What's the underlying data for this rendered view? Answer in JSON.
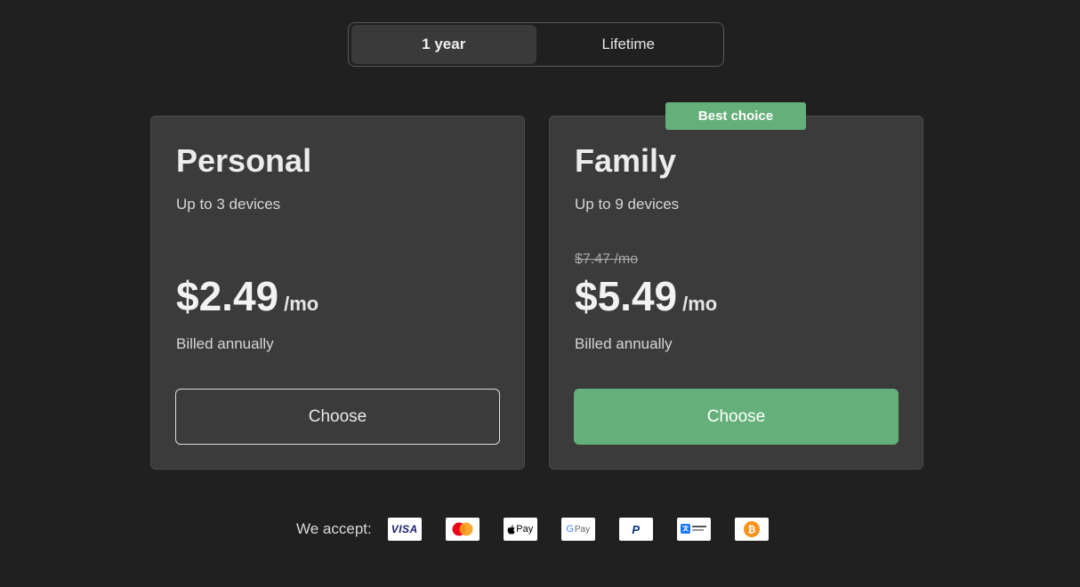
{
  "toggle": {
    "options": [
      {
        "label": "1 year",
        "active": true
      },
      {
        "label": "Lifetime",
        "active": false
      }
    ]
  },
  "plans": [
    {
      "name": "Personal",
      "description": "Up to 3 devices",
      "old_price": "",
      "price": "$2.49",
      "per": "/mo",
      "billing": "Billed annually",
      "button": "Choose",
      "badge": ""
    },
    {
      "name": "Family",
      "description": "Up to 9 devices",
      "old_price": "$7.47 /mo",
      "price": "$5.49",
      "per": "/mo",
      "billing": "Billed annually",
      "button": "Choose",
      "badge": "Best choice"
    }
  ],
  "payments": {
    "label": "We accept:",
    "methods": [
      "visa-icon",
      "mastercard-icon",
      "apple-pay-icon",
      "google-pay-icon",
      "paypal-icon",
      "alipay-icon",
      "bitcoin-icon"
    ],
    "visa_text": "VISA",
    "apple_pay_text": "Pay",
    "google_pay_text": "Pay",
    "paypal_text": "P"
  },
  "colors": {
    "background": "#202020",
    "card": "#3b3b3b",
    "accent_green": "#65b07a",
    "visa_blue": "#1a1f71",
    "mastercard_red": "#eb001b",
    "mastercard_yellow": "#f79e1b",
    "paypal_blue": "#003087",
    "alipay_blue": "#1677ff",
    "bitcoin_orange": "#f7931a"
  }
}
